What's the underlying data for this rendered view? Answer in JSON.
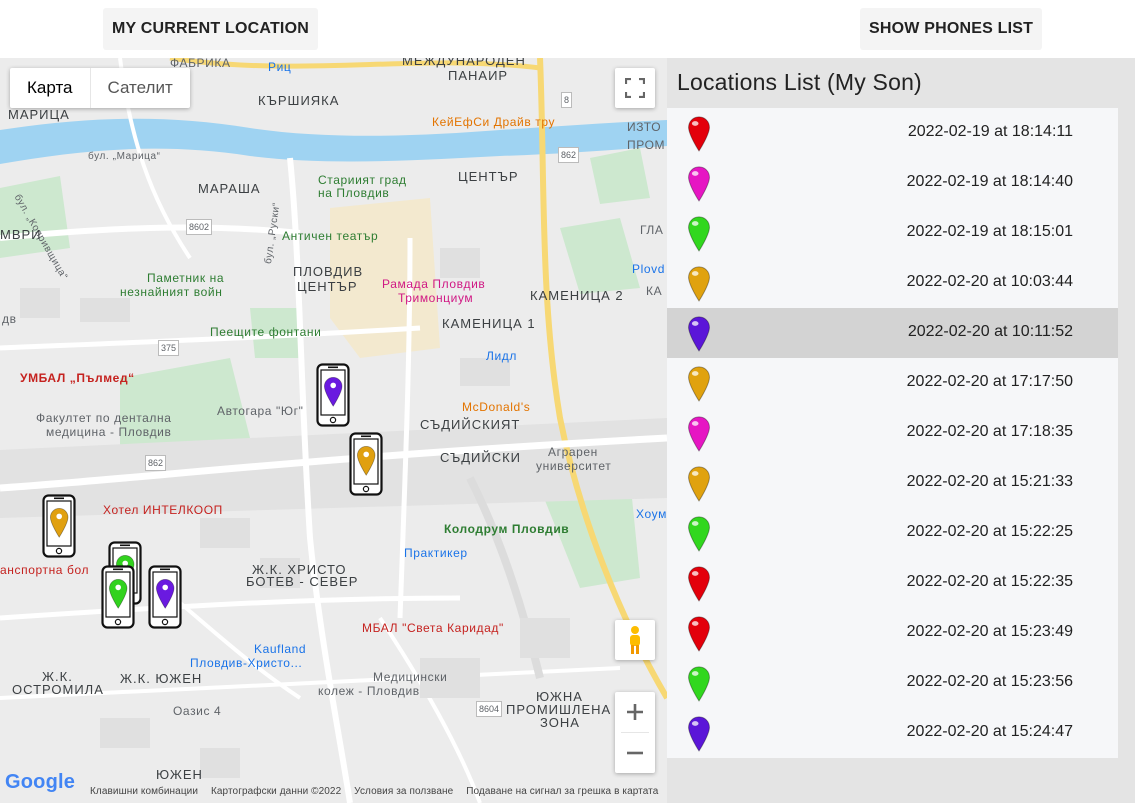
{
  "topbar": {
    "current_location_label": "MY CURRENT LOCATION",
    "show_phones_label": "SHOW PHONES LIST"
  },
  "map": {
    "map_type": {
      "map": "Карта",
      "satellite": "Сателит"
    },
    "labels": {
      "faberika": "ФАБРИКА",
      "ric": "Риц",
      "mezhdunaroden": "МЕЖДУНАРОДЕН",
      "panair": "ПАНАИР",
      "karshiyaka": "КЪРШИЯКА",
      "maritsa": "МАРИЦА",
      "kfc": "КейЕфСи Драйв тру",
      "iztok": "ИЗТО",
      "prom": "ПРОМ",
      "bul_maritsa": "бул. „Марица“",
      "stariyat_grad": "Стариият град",
      "na_plovdiv": "на Пловдив",
      "centar": "ЦЕНТЪР",
      "marasha": "МАРАША",
      "kopr": "бул. „Копривщица“",
      "mvri": "МВРИ",
      "antichen": "Античен театър",
      "gla": "ГЛА",
      "pametnik1": "Паметник на",
      "pametnik2": "незнайният войн",
      "plovdiv_centar1": "ПЛОВДИВ",
      "plovdiv_centar2": "ЦЕНТЪР",
      "ramada1": "Рамада Пловдив",
      "ramada2": "Тримонциум",
      "kamenitsa2": "КАМЕНИЦА 2",
      "plovo": "Plovd",
      "ka": "КА",
      "peeshti": "Пеещите фонтани",
      "kamenitsa1": "КАМЕНИЦА 1",
      "lidl": "Лидл",
      "umbal": "УМБАЛ „Пълмед“",
      "mcd": "McDonald's",
      "avtogara": "Автогара \"Юг\"",
      "fakultet1": "Факултет по дентална",
      "fakultet2": "медицина - Пловдив",
      "sadiyskiyat": "СЪДИЙСКИЯТ",
      "sadiyski": "СЪДИЙСКИ",
      "agraren1": "Аграрен",
      "agraren2": "университет",
      "hotel": "Хотел ИНТЕЛКООП",
      "houm": "Хоум",
      "kolodrum": "Колодрум Пловдив",
      "transportna": "анспортна бол",
      "praktiker": "Практикер",
      "hristo1": "Ж.К. ХРИСТО",
      "hristo2": "БОТЕВ - СЕВЕР",
      "sveta_karidad": "МБАЛ \"Света Каридад\"",
      "kaufland1": "Kaufland",
      "kaufland2": "Пловдив-Христо...",
      "ostromila1": "Ж.К.",
      "ostromila2": "ОСТРОМИЛА",
      "yuzhen_zhk": "Ж.К. ЮЖЕН",
      "medkolej1": "Медицински",
      "medkolej2": "колеж - Пловдив",
      "yuzhna1": "ЮЖНА",
      "yuzhna2": "ПРОМИШЛЕНА",
      "yuzhna3": "ЗОНА",
      "oazis": "Оазис 4",
      "yuzhen": "ЮЖЕН",
      "r8602": "8602",
      "r375": "375",
      "r862a": "862",
      "r862b": "862",
      "r8": "8",
      "r8604": "8604",
      "dv": "дв",
      "bul_ruski": "бул. „Руски“"
    },
    "footer": {
      "shortcuts": "Клавишни комбинации",
      "map_data": "Картографски данни ©2022",
      "terms": "Условия за ползване",
      "report": "Подаване на сигнал за грешка в картата"
    },
    "google_logo": "Google",
    "icons": {
      "fullscreen": "fullscreen-icon",
      "pegman": "pegman-icon",
      "zoom_in": "plus-icon",
      "zoom_out": "minus-icon"
    },
    "phone_markers": [
      {
        "color": "#6a1ae0"
      },
      {
        "color": "#e0a010"
      },
      {
        "color": "#e0a010"
      },
      {
        "color": "#32d21e"
      },
      {
        "color": "#32d21e"
      },
      {
        "color": "#6a1ae0"
      }
    ]
  },
  "panel": {
    "title": "Locations List (My Son)",
    "locations": [
      {
        "color": "#e3000b",
        "timestamp": "2022-02-19 at 18:14:11",
        "selected": false
      },
      {
        "color": "#e616c3",
        "timestamp": "2022-02-19 at 18:14:40",
        "selected": false
      },
      {
        "color": "#31d71e",
        "timestamp": "2022-02-19 at 18:15:01",
        "selected": false
      },
      {
        "color": "#e0a20f",
        "timestamp": "2022-02-20 at 10:03:44",
        "selected": false
      },
      {
        "color": "#5b16d8",
        "timestamp": "2022-02-20 at 10:11:52",
        "selected": true
      },
      {
        "color": "#e0a20f",
        "timestamp": "2022-02-20 at 17:17:50",
        "selected": false
      },
      {
        "color": "#e616c3",
        "timestamp": "2022-02-20 at 17:18:35",
        "selected": false
      },
      {
        "color": "#e0a20f",
        "timestamp": "2022-02-20 at 15:21:33",
        "selected": false
      },
      {
        "color": "#31d71e",
        "timestamp": "2022-02-20 at 15:22:25",
        "selected": false
      },
      {
        "color": "#e3000b",
        "timestamp": "2022-02-20 at 15:22:35",
        "selected": false
      },
      {
        "color": "#e3000b",
        "timestamp": "2022-02-20 at 15:23:49",
        "selected": false
      },
      {
        "color": "#31d71e",
        "timestamp": "2022-02-20 at 15:23:56",
        "selected": false
      },
      {
        "color": "#5b16d8",
        "timestamp": "2022-02-20 at 15:24:47",
        "selected": false
      }
    ]
  }
}
